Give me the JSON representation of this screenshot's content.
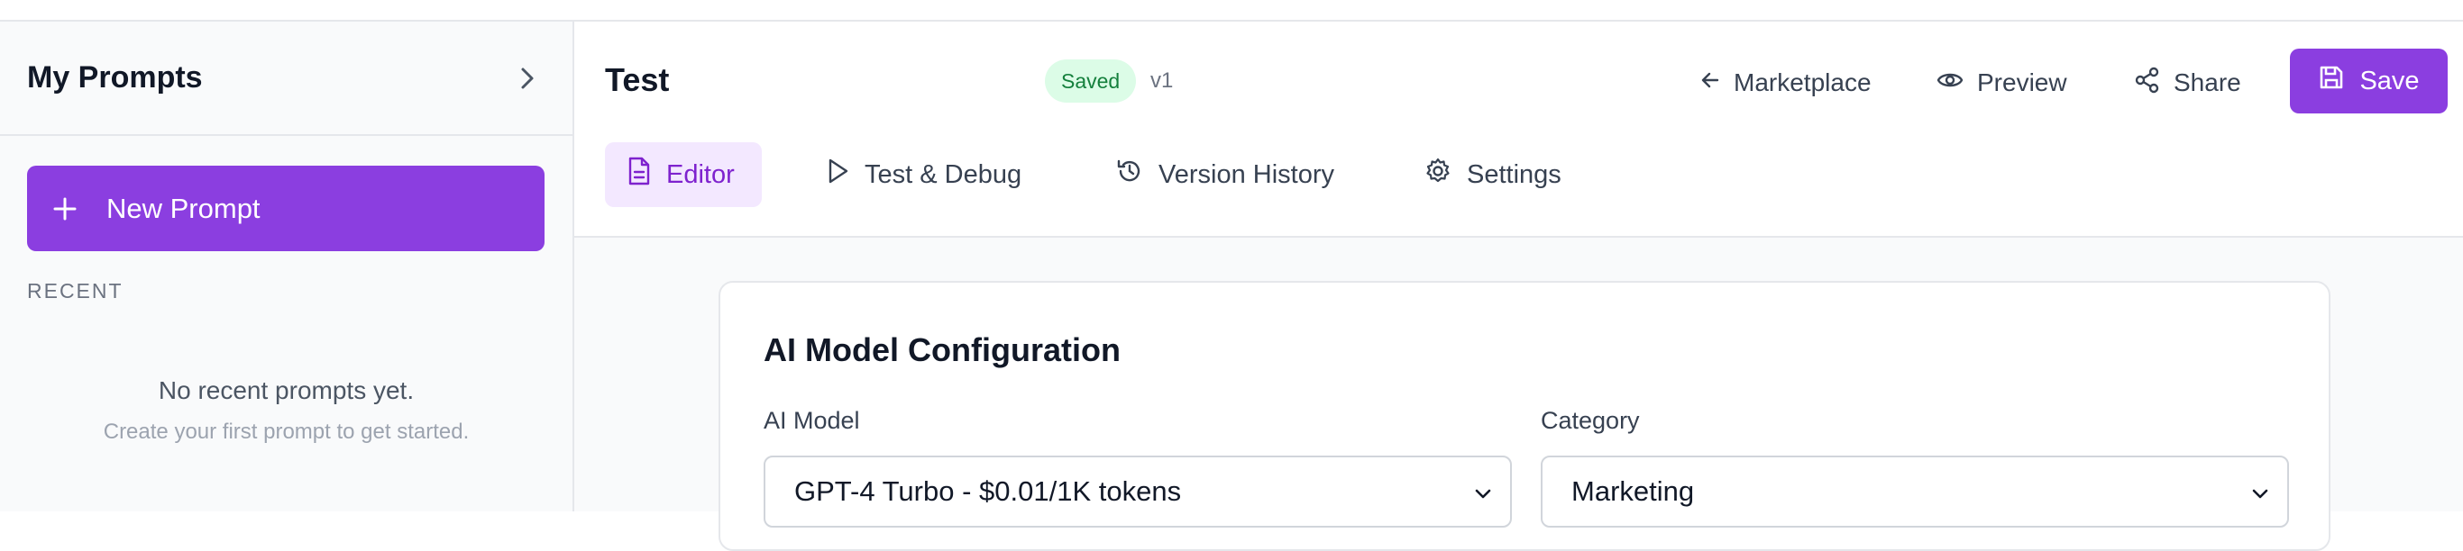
{
  "sidebar": {
    "title": "My Prompts",
    "new_prompt_label": "New Prompt",
    "recent_label": "RECENT",
    "empty_title": "No recent prompts yet.",
    "empty_subtitle": "Create your first prompt to get started."
  },
  "header": {
    "title": "Test",
    "status_badge": "Saved",
    "version": "v1",
    "actions": {
      "marketplace": "Marketplace",
      "preview": "Preview",
      "share": "Share",
      "save": "Save"
    }
  },
  "tabs": [
    {
      "label": "Editor",
      "icon": "document-icon",
      "active": true
    },
    {
      "label": "Test & Debug",
      "icon": "play-icon",
      "active": false
    },
    {
      "label": "Version History",
      "icon": "history-icon",
      "active": false
    },
    {
      "label": "Settings",
      "icon": "gear-icon",
      "active": false
    }
  ],
  "config_card": {
    "title": "AI Model Configuration",
    "model_label": "AI Model",
    "model_value": "GPT-4 Turbo - $0.01/1K tokens",
    "category_label": "Category",
    "category_value": "Marketing"
  },
  "colors": {
    "accent": "#8b3ee0",
    "accent_soft": "#f3e8ff",
    "saved_bg": "#dcfce7",
    "saved_text": "#15803d"
  }
}
